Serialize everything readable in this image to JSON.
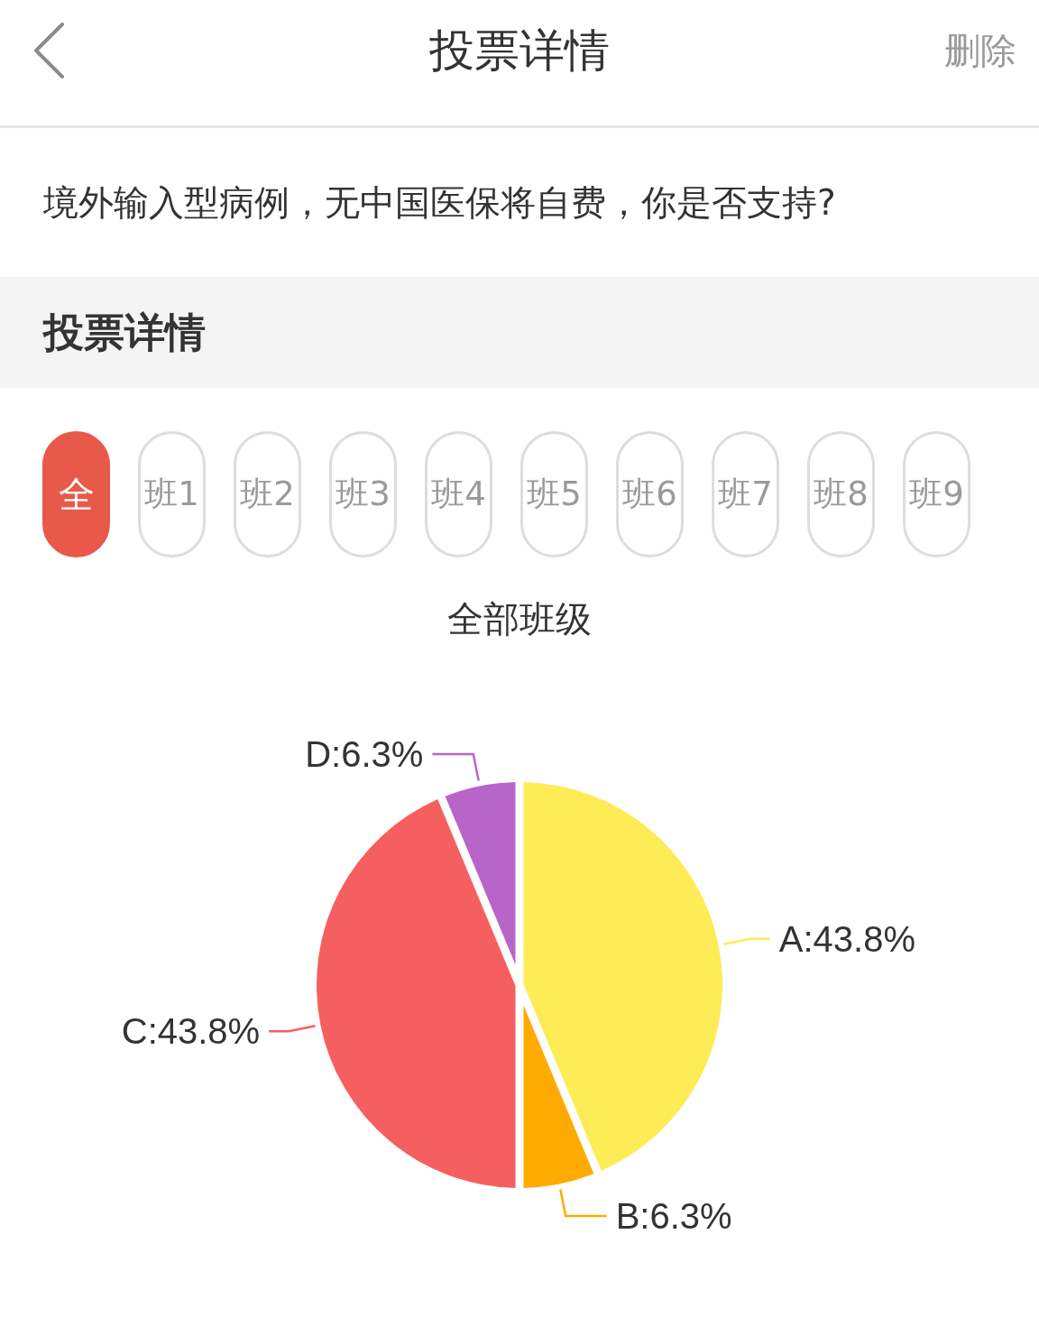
{
  "header": {
    "title": "投票详情",
    "action": "删除"
  },
  "question": "境外输入型病例，无中国医保将自费，你是否支持?",
  "section_title": "投票详情",
  "class_tabs": [
    {
      "label": "全",
      "selected": true
    },
    {
      "label": "班1",
      "selected": false
    },
    {
      "label": "班2",
      "selected": false
    },
    {
      "label": "班3",
      "selected": false
    },
    {
      "label": "班4",
      "selected": false
    },
    {
      "label": "班5",
      "selected": false
    },
    {
      "label": "班6",
      "selected": false
    },
    {
      "label": "班7",
      "selected": false
    },
    {
      "label": "班8",
      "selected": false
    },
    {
      "label": "班9",
      "selected": false
    }
  ],
  "chart_panel": {
    "chart_data": {
      "type": "pie",
      "title": "全部班级",
      "series": [
        {
          "values": [
            43.8,
            6.3,
            43.8,
            6.3
          ]
        }
      ],
      "value_labels": [
        "A:43.8%",
        "B:6.3%",
        "C:43.8%",
        "D:6.3%"
      ],
      "colors": [
        "#fdec55",
        "#ffaa00",
        "#f55f5f",
        "#b865c9"
      ]
    }
  }
}
